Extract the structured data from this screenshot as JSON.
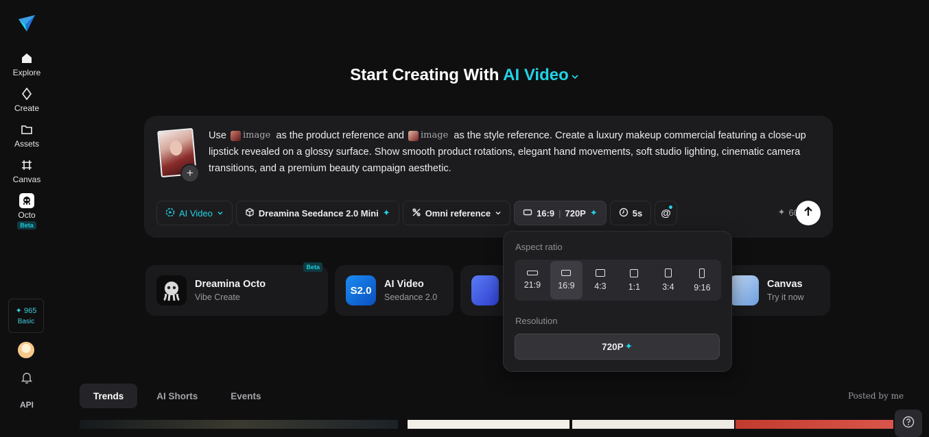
{
  "sidebar": {
    "items": [
      {
        "label": "Explore",
        "icon": "home-icon"
      },
      {
        "label": "Create",
        "icon": "sparkle-diamond-icon"
      },
      {
        "label": "Assets",
        "icon": "folder-icon"
      },
      {
        "label": "Canvas",
        "icon": "canvas-grid-icon"
      },
      {
        "label": "Octo",
        "icon": "octo-icon",
        "badge": "Beta"
      }
    ],
    "credits": {
      "value": "965",
      "plan": "Basic"
    },
    "api_label": "API"
  },
  "headline": {
    "prefix": "Start Creating With",
    "accent": "AI Video"
  },
  "prompt": {
    "seg1": "Use",
    "ref_word": "image",
    "seg2": "as the product reference and",
    "seg3": "as the style reference. Create a luxury makeup commercial featuring a close-up lipstick revealed on a glossy surface. Show smooth product rotations, elegant hand movements, soft studio lighting, cinematic camera transitions, and a premium beauty campaign aesthetic."
  },
  "toolbar": {
    "mode": "AI Video",
    "model": "Dreamina Seedance 2.0 Mini",
    "reference": "Omni reference",
    "ratio": "16:9",
    "resolution": "720P",
    "duration": "5s",
    "mention": "@",
    "cost": "60"
  },
  "cards": [
    {
      "title": "Dreamina Octo",
      "subtitle": "Vibe Create",
      "badge": "Beta"
    },
    {
      "title": "AI Video",
      "subtitle": "Seedance 2.0",
      "icon_text": "S2.0"
    },
    {
      "title": "Canvas",
      "subtitle": "Try it now"
    }
  ],
  "popover": {
    "aspect_label": "Aspect ratio",
    "ratios": [
      "21:9",
      "16:9",
      "4:3",
      "1:1",
      "3:4",
      "9:16"
    ],
    "selected_ratio": "16:9",
    "resolution_label": "Resolution",
    "resolution_value": "720P"
  },
  "feed": {
    "tabs": [
      "Trends",
      "AI Shorts",
      "Events"
    ],
    "selected": "Trends",
    "posted_by": "Posted by me"
  },
  "colors": {
    "accent": "#22d3e8",
    "background": "#0f0f10",
    "card": "#1c1c1f"
  }
}
